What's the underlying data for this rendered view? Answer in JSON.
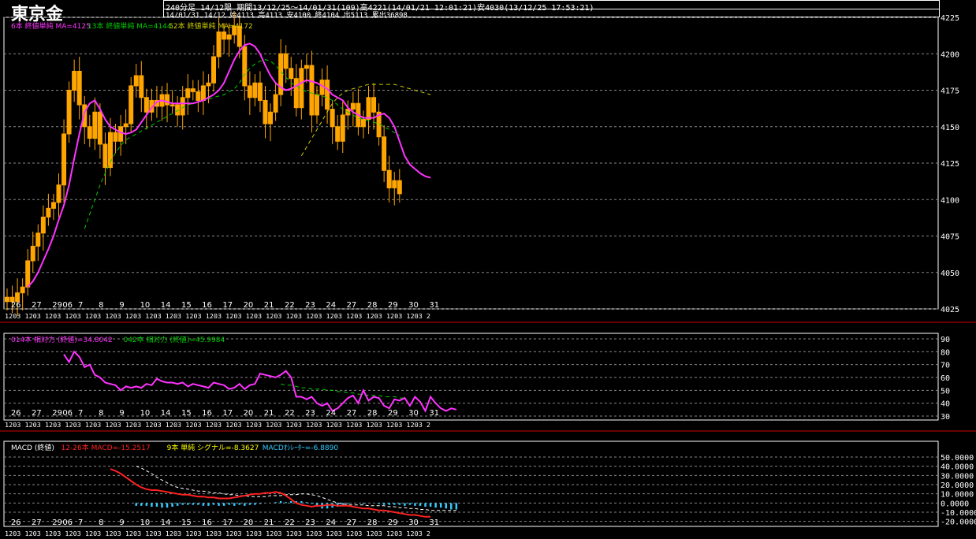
{
  "title": "東京金",
  "header": {
    "line1": "240分足 14/12限 期間13/12/25～14/01/31(109)高4221(14/01/21 12:01:21)安4030(13/12/25 17:53:21)",
    "line2": "14/01/31 14/12 始4113 高4113 安4100 終4104 出5113 累出36898"
  },
  "colors": {
    "background": "#000000",
    "candle": "#ffa500",
    "ma_short": "#ff33ff",
    "ma_mid": "#00cc00",
    "ma_long": "#cccc00",
    "rsi": "#ff33ff",
    "macd": "#ff2222",
    "signal": "#ffffff",
    "oscillator": "#33ccff",
    "grid": "#888888"
  },
  "legends": {
    "price": [
      {
        "text": "6本 終値単純 MA=4125",
        "color": "#ff33ff"
      },
      {
        "text": "13本 終値単純 MA=4144",
        "color": "#00cc00"
      },
      {
        "text": "52本 終値単純 MA=4172",
        "color": "#cccc00"
      }
    ],
    "rsi": [
      {
        "text": "014本 相対力 (終値)=34.8042",
        "color": "#ff33ff"
      },
      {
        "text": "042本 相対力 (終値)=45.9984",
        "color": "#00cc00"
      }
    ],
    "macd": [
      {
        "text": "MACD (終値)",
        "color": "#ffffff"
      },
      {
        "text": "12-26本 MACD=-15.2517",
        "color": "#ff2222"
      },
      {
        "text": "9本 単純 シグナル=-8.3627",
        "color": "#ffff00"
      },
      {
        "text": "MACDｵｼﾚｰﾀｰ=-6.8890",
        "color": "#33ccff"
      }
    ]
  },
  "chart_data": [
    {
      "type": "candlestick",
      "name": "price",
      "y_ticks": [
        4025,
        4050,
        4075,
        4100,
        4125,
        4150,
        4175,
        4200,
        4225
      ],
      "ylim": [
        4025,
        4225
      ],
      "day_labels": [
        {
          "label": "26",
          "index": 1.5
        },
        {
          "label": "27",
          "index": 5.5
        },
        {
          "label": "29",
          "index": 9.5
        },
        {
          "label": "06",
          "index": 11.5
        },
        {
          "label": "7",
          "index": 14.5
        },
        {
          "label": "8",
          "index": 18.5
        },
        {
          "label": "9",
          "index": 22.5
        },
        {
          "label": "10",
          "index": 26.5
        },
        {
          "label": "14",
          "index": 30.5
        },
        {
          "label": "15",
          "index": 34.5
        },
        {
          "label": "16",
          "index": 38.5
        },
        {
          "label": "17",
          "index": 42.5
        },
        {
          "label": "20",
          "index": 46.5
        },
        {
          "label": "21",
          "index": 50.5
        },
        {
          "label": "22",
          "index": 54.5
        },
        {
          "label": "23",
          "index": 58.5
        },
        {
          "label": "24",
          "index": 62.5
        },
        {
          "label": "27",
          "index": 66.5
        },
        {
          "label": "28",
          "index": 70.5
        },
        {
          "label": "29",
          "index": 74.5
        },
        {
          "label": "30",
          "index": 78.5
        },
        {
          "label": "31",
          "index": 82.5
        }
      ],
      "x_axis_strip": "1203 1203 1203 1203 1203 1203 1203 1203 1203 1203 1203 1203 1203 1203 1203 1203 1203 1203 1203 1203 1203 2",
      "close": [
        4033,
        4030,
        4036,
        4040,
        4058,
        4068,
        4077,
        4088,
        4094,
        4098,
        4110,
        4145,
        4175,
        4188,
        4165,
        4150,
        4142,
        4160,
        4138,
        4122,
        4146,
        4140,
        4150,
        4152,
        4178,
        4185,
        4170,
        4160,
        4168,
        4164,
        4172,
        4165,
        4165,
        4158,
        4170,
        4176,
        4174,
        4168,
        4178,
        4180,
        4198,
        4215,
        4210,
        4213,
        4219,
        4205,
        4178,
        4170,
        4180,
        4168,
        4152,
        4160,
        4172,
        4200,
        4190,
        4183,
        4163,
        4190,
        4192,
        4158,
        4172,
        4182,
        4162,
        4150,
        4140,
        4158,
        4162,
        4166,
        4150,
        4155,
        4170,
        4160,
        4143,
        4120,
        4108,
        4113,
        4104
      ],
      "open": [
        4030,
        4033,
        4030,
        4036,
        4040,
        4058,
        4068,
        4077,
        4088,
        4094,
        4098,
        4110,
        4145,
        4175,
        4188,
        4165,
        4150,
        4142,
        4160,
        4138,
        4122,
        4146,
        4140,
        4150,
        4152,
        4178,
        4185,
        4170,
        4160,
        4168,
        4164,
        4172,
        4165,
        4165,
        4158,
        4170,
        4176,
        4174,
        4168,
        4178,
        4180,
        4198,
        4215,
        4210,
        4213,
        4219,
        4205,
        4178,
        4170,
        4180,
        4168,
        4152,
        4160,
        4172,
        4200,
        4190,
        4183,
        4163,
        4190,
        4192,
        4158,
        4172,
        4182,
        4162,
        4150,
        4140,
        4158,
        4162,
        4166,
        4150,
        4155,
        4170,
        4160,
        4143,
        4120,
        4108,
        4113
      ],
      "ma6": [
        4040,
        4044,
        4050,
        4058,
        4066,
        4075,
        4086,
        4096,
        4110,
        4128,
        4145,
        4160,
        4166,
        4168,
        4162,
        4155,
        4150,
        4148,
        4146,
        4145,
        4146,
        4148,
        4153,
        4158,
        4163,
        4167,
        4168,
        4167,
        4166,
        4166,
        4166,
        4166,
        4166,
        4167,
        4168,
        4170,
        4172,
        4175,
        4180,
        4188,
        4196,
        4202,
        4206,
        4207,
        4205,
        4200,
        4192,
        4185,
        4180,
        4177,
        4175,
        4176,
        4178,
        4180,
        4182,
        4181,
        4180,
        4178,
        4176,
        4172,
        4170,
        4168,
        4163,
        4160,
        4158,
        4156,
        4156,
        4156,
        4158,
        4159,
        4156,
        4150,
        4140,
        4130,
        4124,
        4121,
        4118,
        4116,
        4115
      ],
      "ma13": [
        4080,
        4090,
        4100,
        4110,
        4118,
        4126,
        4132,
        4137,
        4141,
        4143,
        4145,
        4147,
        4149,
        4151,
        4153,
        4155,
        4157,
        4159,
        4161,
        4163,
        4165,
        4166,
        4167,
        4168,
        4169,
        4170,
        4171,
        4172,
        4174,
        4176,
        4180,
        4186,
        4190,
        4193,
        4195,
        4196,
        4195,
        4192,
        4188,
        4184,
        4180,
        4178,
        4176,
        4174,
        4173,
        4172,
        4171,
        4170,
        4168,
        4165,
        4162,
        4160,
        4158,
        4156,
        4155,
        4154,
        4153,
        4152,
        4150,
        4148,
        4146,
        4144
      ],
      "ma52": [
        4130,
        4136,
        4142,
        4148,
        4154,
        4160,
        4166,
        4170,
        4173,
        4175,
        4176,
        4177,
        4178,
        4179,
        4179,
        4179,
        4179,
        4179,
        4179,
        4178,
        4177,
        4176,
        4175,
        4174,
        4173,
        4172
      ]
    },
    {
      "type": "line",
      "name": "rsi",
      "y_ticks": [
        30,
        40,
        50,
        60,
        70,
        80,
        90
      ],
      "ylim": [
        30,
        90
      ],
      "rsi14": [
        78,
        72,
        80,
        76,
        68,
        70,
        62,
        60,
        56,
        55,
        54,
        50,
        53,
        52,
        53,
        52,
        55,
        54,
        59,
        57,
        56,
        56,
        55,
        56,
        53,
        55,
        54,
        53,
        52,
        56,
        55,
        54,
        51,
        52,
        55,
        51,
        54,
        55,
        63,
        62,
        61,
        60,
        62,
        65,
        60,
        45,
        45,
        43,
        45,
        40,
        38,
        40,
        34,
        36,
        40,
        44,
        46,
        40,
        50,
        42,
        45,
        44,
        38,
        36,
        43,
        42,
        44,
        38,
        45,
        41,
        34,
        45,
        40,
        36,
        34,
        36,
        35
      ],
      "rsi42": [
        55,
        54,
        54,
        53,
        52,
        52,
        51,
        51,
        51,
        50,
        50,
        49,
        49,
        48,
        48,
        47,
        47,
        46,
        46,
        46,
        45,
        45,
        45,
        44,
        44
      ]
    },
    {
      "type": "line",
      "name": "macd",
      "y_ticks": [
        50,
        40,
        30,
        20,
        10,
        0,
        -10,
        -20
      ],
      "ylim": [
        -22,
        50
      ],
      "macd": [
        37,
        35,
        32,
        28,
        24,
        20,
        17,
        15,
        14,
        14,
        13,
        12,
        11,
        10,
        9,
        9,
        8,
        7,
        7,
        6,
        6,
        5,
        5,
        5,
        6,
        7,
        8,
        9,
        10,
        10,
        11,
        11,
        12,
        11,
        8,
        4,
        0,
        -2,
        -3,
        -4,
        -3,
        -3,
        -2,
        -2,
        -3,
        -3,
        -3,
        -4,
        -5,
        -6,
        -6,
        -7,
        -8,
        -8,
        -9,
        -10,
        -11,
        -12,
        -13,
        -13,
        -14,
        -15,
        -15
      ],
      "signal": [
        40,
        38,
        35,
        32,
        28,
        25,
        22,
        19,
        17,
        16,
        15,
        14,
        13,
        13,
        12,
        11,
        11,
        10,
        9,
        9,
        8,
        8,
        7,
        7,
        7,
        7,
        8,
        8,
        8,
        9,
        9,
        9,
        10,
        10,
        9,
        8,
        6,
        4,
        2,
        0,
        -1,
        -2,
        -2,
        -2,
        -2,
        -3,
        -3,
        -3,
        -3,
        -4,
        -4,
        -5,
        -5,
        -6,
        -6,
        -7,
        -7,
        -8,
        -8,
        -8,
        -8,
        -8,
        -8
      ],
      "osc": [
        -3,
        -3,
        -3,
        -4,
        -4,
        -5,
        -5,
        -4,
        -3,
        -2,
        -2,
        -2,
        -2,
        -3,
        -3,
        -2,
        -3,
        -3,
        -2,
        -3,
        -2,
        -3,
        -2,
        -2,
        -1,
        0,
        0,
        1,
        2,
        1,
        2,
        2,
        2,
        1,
        -1,
        -4,
        -6,
        -6,
        -5,
        -4,
        -2,
        -1,
        0,
        0,
        -1,
        0,
        0,
        -1,
        -2,
        -2,
        -2,
        -2,
        -3,
        -2,
        -3,
        -3,
        -4,
        -4,
        -5,
        -5,
        -6,
        -7,
        -7
      ]
    }
  ]
}
